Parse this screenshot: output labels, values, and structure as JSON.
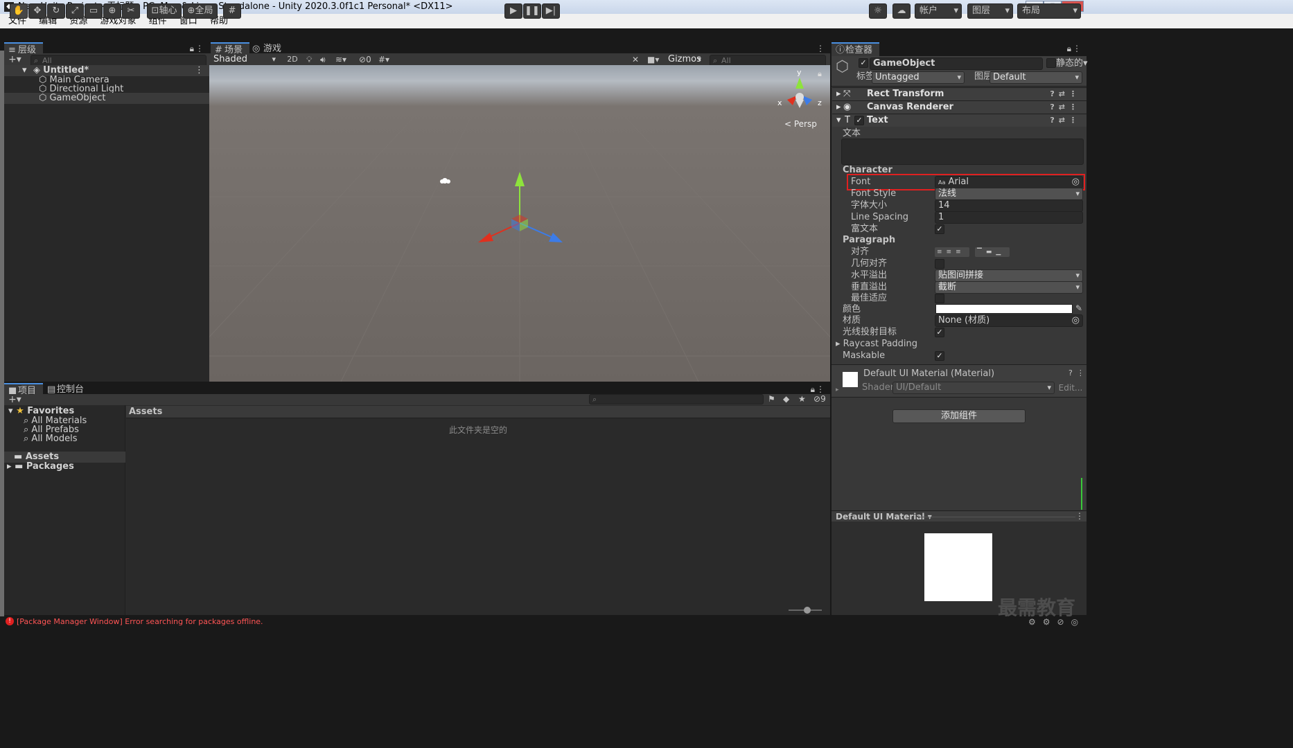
{
  "window": {
    "title": "New Unity Project - 无标题 - PC, Mac & Linux Standalone - Unity 2020.3.0f1c1 Personal* <DX11>",
    "minimize": "▁",
    "maximize": "▢",
    "close": "✕"
  },
  "menu": [
    "文件",
    "编辑",
    "资源",
    "游戏对象",
    "组件",
    "窗口",
    "帮助"
  ],
  "toolbar": {
    "pivot_label": "轴心",
    "global_label": "全局",
    "account_label": "帐户",
    "layers_label": "图层",
    "layout_label": "布局"
  },
  "hierarchy": {
    "tab_label": "层级",
    "search_placeholder": "All",
    "scene_name": "Untitled*",
    "items": [
      "Main Camera",
      "Directional Light",
      "GameObject"
    ]
  },
  "scene": {
    "tab_scene": "场景",
    "tab_game": "游戏",
    "shading_mode": "Shaded",
    "mode_2d": "2D",
    "hidden_count": "0",
    "gizmos_label": "Gizmos",
    "search_placeholder": "All",
    "persp_label": "< Persp",
    "axis_y": "y",
    "axis_x": "x",
    "axis_z": "z"
  },
  "project": {
    "tab_project": "项目",
    "tab_console": "控制台",
    "favorites_label": "Favorites",
    "favorites": [
      "All Materials",
      "All Prefabs",
      "All Models"
    ],
    "folders": [
      "Assets",
      "Packages"
    ],
    "breadcrumb": "Assets",
    "empty_message": "此文件夹是空的",
    "hidden_packages_count": "9"
  },
  "inspector": {
    "tab_label": "检查器",
    "object_name": "GameObject",
    "static_label": "静态的",
    "tag_label": "标签",
    "tag_value": "Untagged",
    "layer_label": "图层",
    "layer_value": "Default",
    "components": [
      "Rect Transform",
      "Canvas Renderer",
      "Text"
    ],
    "text_label": "文本",
    "text_value": "",
    "character_header": "Character",
    "font_label": "Font",
    "font_value": "Arial",
    "font_prefix": "Aa",
    "font_style_label": "Font Style",
    "font_style_value": "法线",
    "font_size_label": "字体大小",
    "font_size_value": "14",
    "line_spacing_label": "Line Spacing",
    "line_spacing_value": "1",
    "rich_text_label": "富文本",
    "paragraph_header": "Paragraph",
    "alignment_label": "对齐",
    "align_by_geometry_label": "几何对齐",
    "horizontal_overflow_label": "水平溢出",
    "horizontal_overflow_value": "贴图间拼接",
    "vertical_overflow_label": "垂直溢出",
    "vertical_overflow_value": "截断",
    "best_fit_label": "最佳适应",
    "color_label": "颜色",
    "color_value": "#ffffff",
    "material_label": "材质",
    "material_value": "None (材质)",
    "raycast_target_label": "光线投射目标",
    "raycast_padding_label": "Raycast Padding",
    "maskable_label": "Maskable",
    "material_asset_name": "Default UI Material (Material)",
    "shader_label": "Shader",
    "shader_value": "UI/Default",
    "edit_label": "Edit...",
    "add_component_label": "添加组件",
    "preview_title": "Default UI Material"
  },
  "status": {
    "error_message": "[Package Manager Window] Error searching for packages offline."
  },
  "watermark": "最需教育",
  "colors": {
    "highlight_red": "#e02020",
    "accent_blue": "#4a90e2",
    "error_red": "#ff5555"
  }
}
